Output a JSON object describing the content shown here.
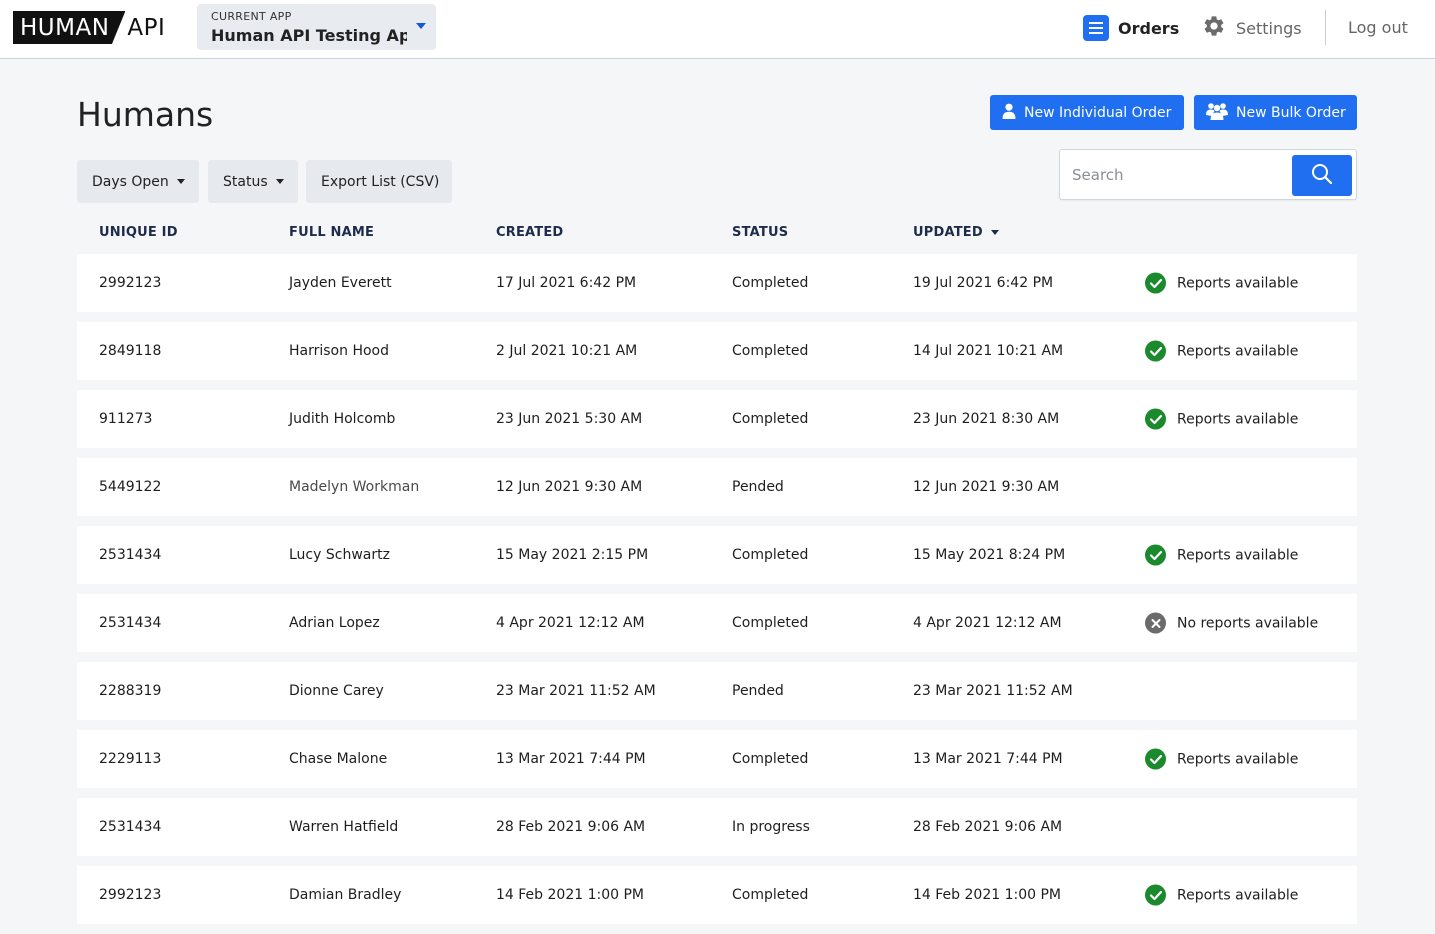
{
  "header": {
    "logo_main": "HUMAN",
    "logo_suffix": "API",
    "app_switcher": {
      "caption": "CURRENT APP",
      "value": "Human API Testing Ap..."
    },
    "nav": {
      "orders": "Orders",
      "settings": "Settings",
      "logout": "Log out"
    },
    "colors": {
      "accent": "#1f6ff0"
    }
  },
  "page": {
    "title": "Humans",
    "actions": {
      "new_individual": "New Individual Order",
      "new_bulk": "New Bulk Order"
    },
    "filters": {
      "days_open": "Days Open",
      "status": "Status",
      "export": "Export List (CSV)"
    },
    "search": {
      "placeholder": "Search",
      "icon": "search-icon"
    }
  },
  "table": {
    "columns": {
      "id": "UNIQUE ID",
      "name": "FULL NAME",
      "created": "CREATED",
      "status": "STATUS",
      "updated": "UPDATED"
    },
    "sorted_by": "UPDATED",
    "rows": [
      {
        "id": "2992123",
        "name": "Jayden Everett",
        "created": "17 Jul 2021 6:42 PM",
        "status": "Completed",
        "updated": "19 Jul 2021 6:42 PM",
        "report": "Reports available",
        "report_state": "available"
      },
      {
        "id": "2849118",
        "name": "Harrison Hood",
        "created": "2 Jul 2021 10:21 AM",
        "status": "Completed",
        "updated": "14 Jul 2021 10:21 AM",
        "report": "Reports available",
        "report_state": "available"
      },
      {
        "id": "911273",
        "name": "Judith Holcomb",
        "created": "23 Jun 2021 5:30 AM",
        "status": "Completed",
        "updated": "23 Jun 2021 8:30 AM",
        "report": "Reports available",
        "report_state": "available"
      },
      {
        "id": "5449122",
        "name": "Madelyn Workman",
        "created": "12 Jun 2021 9:30 AM",
        "status": "Pended",
        "updated": "12 Jun 2021 9:30 AM",
        "report": "",
        "report_state": "none"
      },
      {
        "id": "2531434",
        "name": "Lucy Schwartz",
        "created": "15 May 2021 2:15 PM",
        "status": "Completed",
        "updated": "15 May 2021 8:24 PM",
        "report": "Reports available",
        "report_state": "available"
      },
      {
        "id": "2531434",
        "name": "Adrian Lopez",
        "created": "4 Apr 2021 12:12 AM",
        "status": "Completed",
        "updated": "4 Apr 2021 12:12 AM",
        "report": "No reports available",
        "report_state": "unavailable"
      },
      {
        "id": "2288319",
        "name": "Dionne Carey",
        "created": "23 Mar 2021 11:52 AM",
        "status": "Pended",
        "updated": "23 Mar 2021 11:52 AM",
        "report": "",
        "report_state": "none"
      },
      {
        "id": "2229113",
        "name": "Chase Malone",
        "created": "13 Mar 2021 7:44 PM",
        "status": "Completed",
        "updated": "13 Mar 2021 7:44 PM",
        "report": "Reports available",
        "report_state": "available"
      },
      {
        "id": "2531434",
        "name": "Warren Hatfield",
        "created": "28 Feb 2021 9:06 AM",
        "status": "In progress",
        "updated": "28 Feb 2021 9:06 AM",
        "report": "",
        "report_state": "none"
      },
      {
        "id": "2992123",
        "name": "Damian Bradley",
        "created": "14 Feb 2021 1:00 PM",
        "status": "Completed",
        "updated": "14 Feb 2021 1:00 PM",
        "report": "Reports available",
        "report_state": "available"
      }
    ]
  }
}
